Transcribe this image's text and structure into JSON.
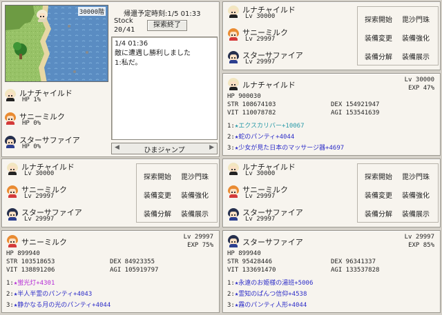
{
  "colors": {
    "panel_bg": "#f7f4ee",
    "border": "#9b9890",
    "equip_blue": "#2c2cc8",
    "equip_purple": "#b52cd6",
    "star_teal": "#2a9aa8"
  },
  "dungeon": {
    "floor": "30000階",
    "return_label": "帰還予定時刻:1/5 01:33",
    "stock_label": "Stock",
    "stock_value": "20/41",
    "end_button": "探索終了",
    "party": [
      {
        "name": "ルナチャイルド",
        "stat": "HP 1%"
      },
      {
        "name": "サニーミルク",
        "stat": "HP 0%"
      },
      {
        "name": "スターサファイア",
        "stat": "HP 0%"
      }
    ],
    "log": [
      "1/4 01:36",
      "敵に遭遇し勝利しました",
      "1:私だ。"
    ],
    "jump_button": "ひまジャンプ",
    "jump_left": "◀",
    "jump_right": "▶"
  },
  "commands": {
    "explore": "探索開始",
    "bishamon": "毘沙門珠",
    "equip_change": "装備変更",
    "equip_strengthen": "装備強化",
    "equip_disassemble": "装備分解",
    "equip_display": "装備展示"
  },
  "parties": [
    {
      "members": [
        {
          "name": "ルナチャイルド",
          "level": "Lv 30000"
        },
        {
          "name": "サニーミルク",
          "level": "Lv 29997"
        },
        {
          "name": "スターサファイア",
          "level": "Lv 29997"
        }
      ]
    },
    {
      "members": [
        {
          "name": "ルナチャイルド",
          "level": "Lv 30000"
        },
        {
          "name": "サニーミルク",
          "level": "Lv 29997"
        },
        {
          "name": "スターサファイア",
          "level": "Lv 29997"
        }
      ]
    },
    {
      "members": [
        {
          "name": "ルナチャイルド",
          "level": "Lv 30000"
        },
        {
          "name": "サニーミルク",
          "level": "Lv 29997"
        },
        {
          "name": "スターサファイア",
          "level": "Lv 29997"
        }
      ]
    }
  ],
  "details": [
    {
      "name": "ルナチャイルド",
      "level": "Lv 30000",
      "exp": "EXP 47%",
      "hp": "HP  900030",
      "str": "STR 108674103",
      "dex": "DEX 154921947",
      "vit": "VIT 110078782",
      "agi": "AGI 153541639",
      "equips": [
        {
          "num": "1:",
          "star": "★",
          "name": "エクスカリバー+10067"
        },
        {
          "num": "2:",
          "star": "★",
          "name": "蛇のパンティ+4044"
        },
        {
          "num": "3:",
          "star": "★",
          "name": "少女が見た日本のマッサージ器+4697"
        }
      ]
    },
    {
      "name": "サニーミルク",
      "level": "Lv 29997",
      "exp": "EXP 75%",
      "hp": "HP  899940",
      "str": "STR 103518653",
      "dex": "DEX 84923355",
      "vit": "VIT 138891206",
      "agi": "AGI 105919797",
      "equips": [
        {
          "num": "1:",
          "star": "★",
          "name": "蛍光灯+4301"
        },
        {
          "num": "2:",
          "star": "★",
          "name": "半人半霊のパンティ+4043"
        },
        {
          "num": "3:",
          "star": "★",
          "name": "静かなる月の光のパンティ+4044"
        }
      ]
    },
    {
      "name": "スターサファイア",
      "level": "Lv 29997",
      "exp": "EXP 85%",
      "hp": "HP  899940",
      "str": "STR 95428446",
      "dex": "DEX 96341337",
      "vit": "VIT 133691470",
      "agi": "AGI 133537828",
      "equips": [
        {
          "num": "1:",
          "star": "★",
          "name": "永遠のお姫様の湯班+5006"
        },
        {
          "num": "2:",
          "star": "★",
          "name": "霊知のぱんつ信仰+4538"
        },
        {
          "num": "3:",
          "star": "★",
          "name": "霧のパンティ人形+4044"
        }
      ]
    }
  ]
}
